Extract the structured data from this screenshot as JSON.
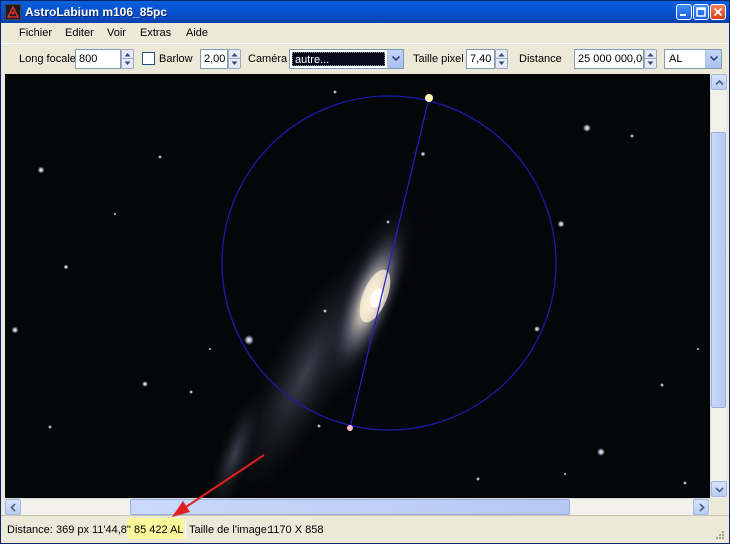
{
  "window": {
    "title": "AstroLabium m106_85pc"
  },
  "menu": {
    "items": [
      "Fichier",
      "Editer",
      "Voir",
      "Extras",
      "Aide"
    ]
  },
  "toolbar": {
    "focal_label": "Long focale",
    "focal_value": "800",
    "barlow_label": "Barlow",
    "barlow_checked": false,
    "barlow_value": "2,00",
    "camera_label": "Caméra",
    "camera_value": "autre...",
    "pixel_label": "Taille pixel",
    "pixel_value": "7,40",
    "distance_label": "Distance",
    "distance_value": "25 000 000,00",
    "unit_value": "AL"
  },
  "statusbar": {
    "distance_label": "Distance:",
    "distance_px": "369 px",
    "distance_angle": "11'44,8\"",
    "distance_ly": "85 422 AL",
    "size_label": "Taille de l'image:",
    "size_value": "1170 X 858"
  },
  "colors": {
    "measure_circle": "#1a1aa8",
    "measure_line": "#2020c8",
    "highlight": "#faf89a",
    "annotation_arrow": "#e02020",
    "titlebar": "#0453d2"
  },
  "icons": {
    "app": "astrolabium-icon",
    "minimize": "minimize-icon",
    "maximize": "maximize-icon",
    "close": "close-icon"
  }
}
